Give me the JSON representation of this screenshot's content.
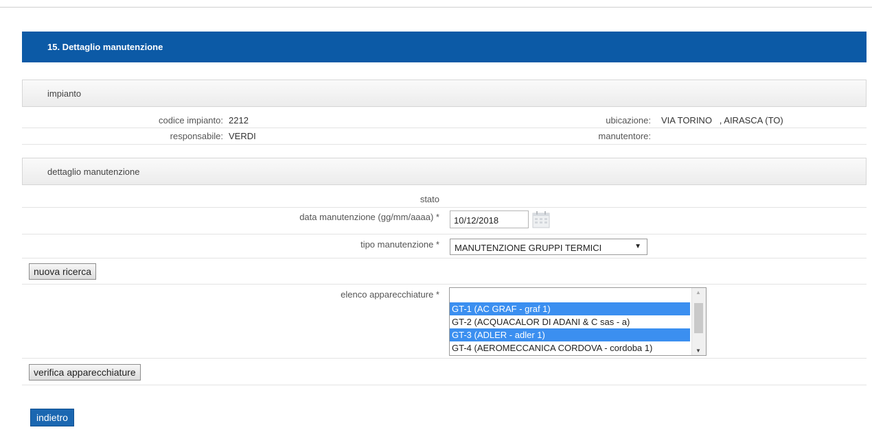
{
  "header": {
    "title": "15. Dettaglio manutenzione"
  },
  "impianto": {
    "section_title": "impianto",
    "codice_label": "codice impianto:",
    "codice_value": "2212",
    "ubicazione_label": "ubicazione:",
    "ubicazione_value": "VIA TORINO   , AIRASCA (TO)",
    "responsabile_label": "responsabile:",
    "responsabile_value": "VERDI",
    "manutentore_label": "manutentore:",
    "manutentore_value": ""
  },
  "dettaglio": {
    "section_title": "dettaglio manutenzione",
    "stato_label": "stato",
    "data_label": "data manutenzione (gg/mm/aaaa) *",
    "data_value": "10/12/2018",
    "tipo_label": "tipo manutenzione *",
    "tipo_value": "MANUTENZIONE GRUPPI TERMICI",
    "nuova_ricerca_label": "nuova ricerca",
    "elenco_label": "elenco apparecchiature *",
    "apparecchiature": [
      {
        "label": "GT-1 (AC GRAF - graf 1)",
        "selected": true
      },
      {
        "label": "GT-2 (ACQUACALOR DI ADANI & C sas - a)",
        "selected": false
      },
      {
        "label": "GT-3 (ADLER - adler 1)",
        "selected": true
      },
      {
        "label": "GT-4 (AEROMECCANICA CORDOVA - cordoba 1)",
        "selected": false
      }
    ],
    "verifica_label": "verifica apparecchiature"
  },
  "footer": {
    "indietro_label": "indietro"
  },
  "colors": {
    "header_blue": "#0c5aa6",
    "selection_blue": "#3b8ff0",
    "button_blue": "#1b67b1"
  }
}
